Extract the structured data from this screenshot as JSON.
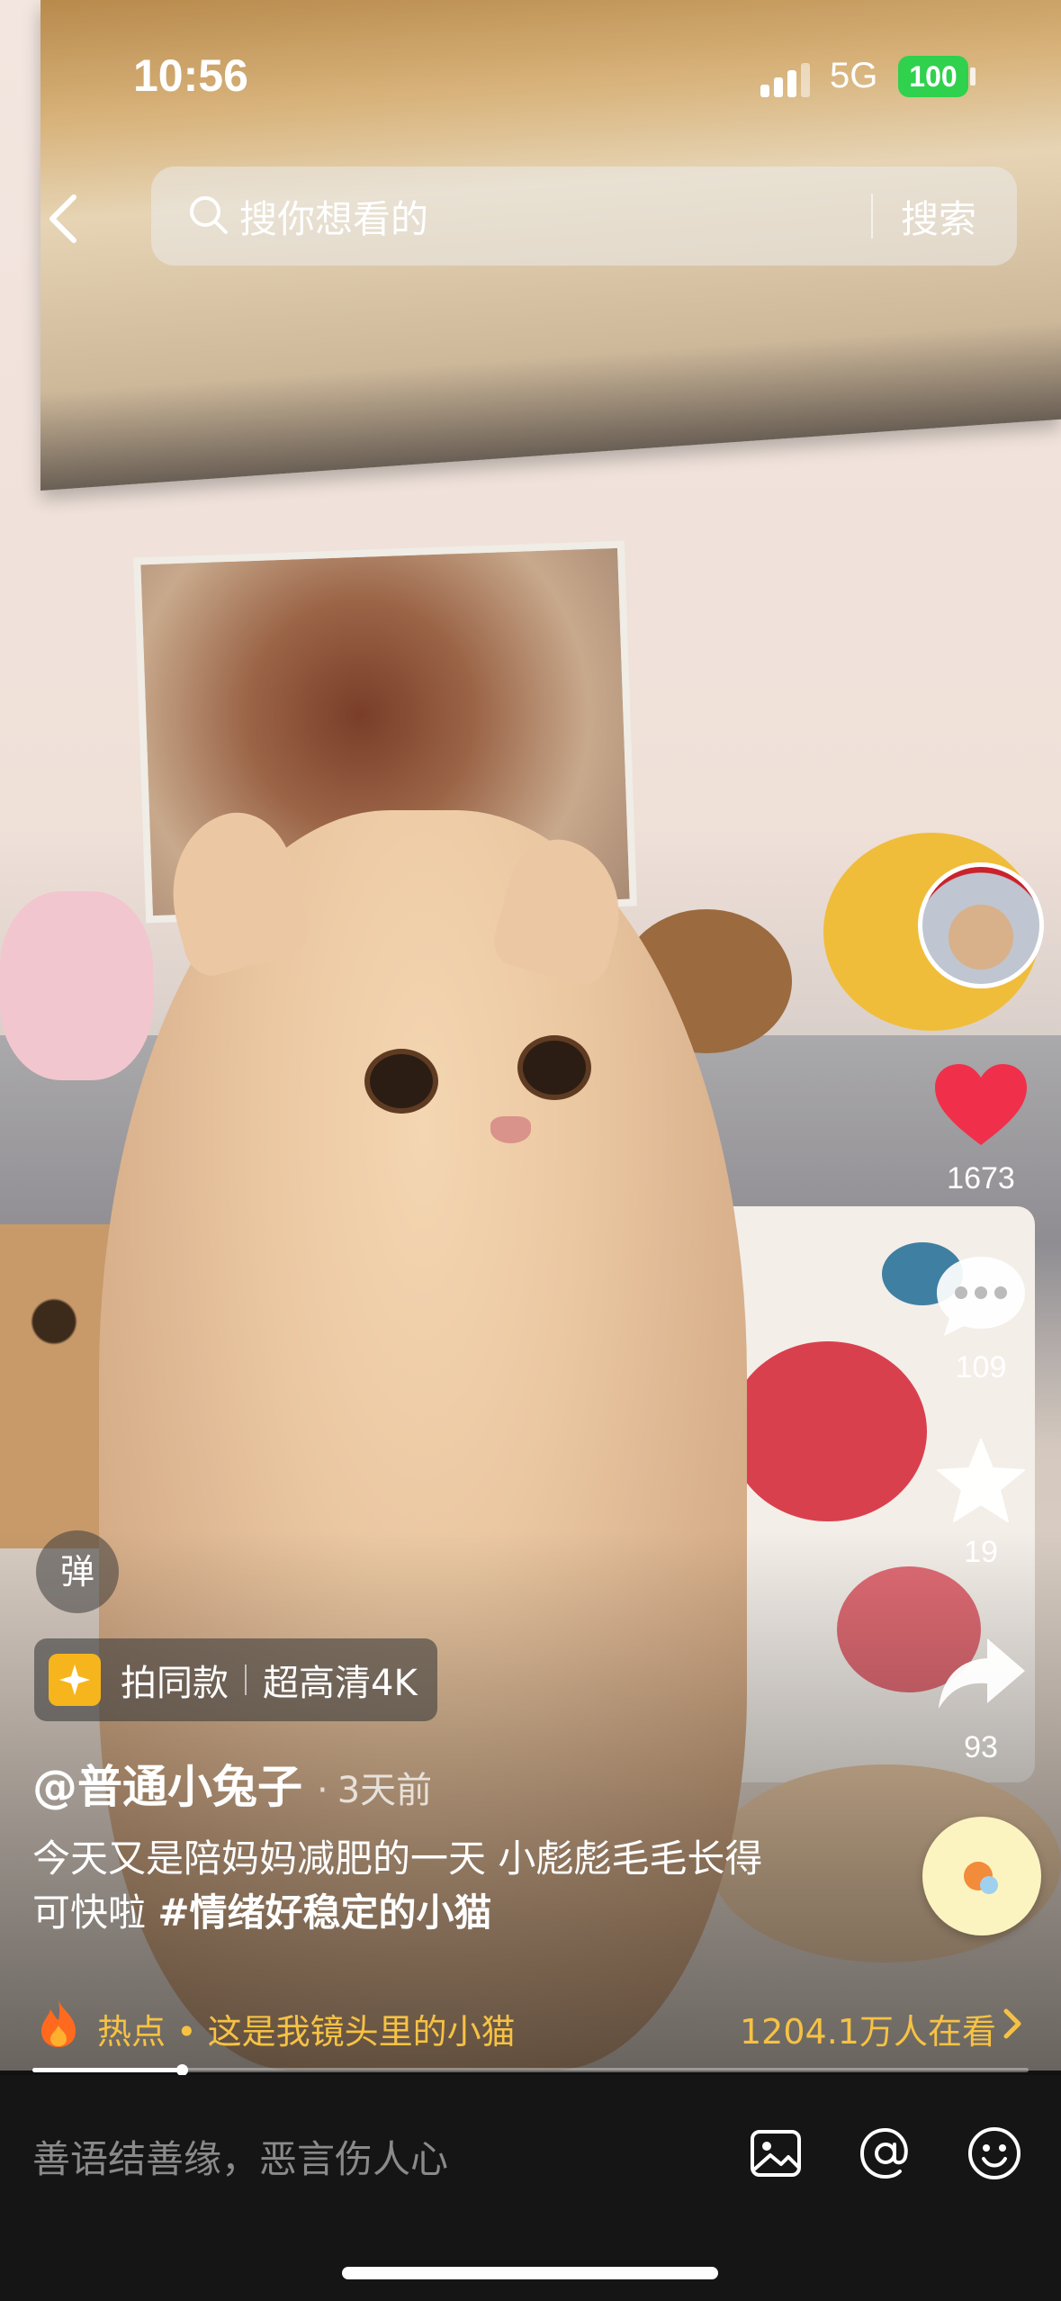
{
  "status_bar": {
    "time": "10:56",
    "network": "5G",
    "battery": "100"
  },
  "search": {
    "placeholder": "搜你想看的",
    "button_label": "搜索"
  },
  "rail": {
    "likes": "1673",
    "comments": "109",
    "favorites": "19",
    "shares": "93"
  },
  "danmu_label": "弹",
  "same_style": {
    "label": "拍同款",
    "quality": "超高清4K"
  },
  "post": {
    "author": "@普通小兔子",
    "time": "3天前",
    "caption": "今天又是陪妈妈减肥的一天 小彪彪毛毛长得可快啦 ",
    "hashtag": "#情绪好稳定的小猫"
  },
  "hot": {
    "label": "热点 • 这是我镜头里的小猫",
    "viewers": "1204.1万人在看"
  },
  "playback": {
    "progress": 0.15
  },
  "comment": {
    "placeholder": "善语结善缘，恶言伤人心"
  },
  "colors": {
    "like": "#f0304a",
    "hot_text": "#f6c244",
    "sparkle": "#f6b51c",
    "battery": "#2fd14d"
  }
}
